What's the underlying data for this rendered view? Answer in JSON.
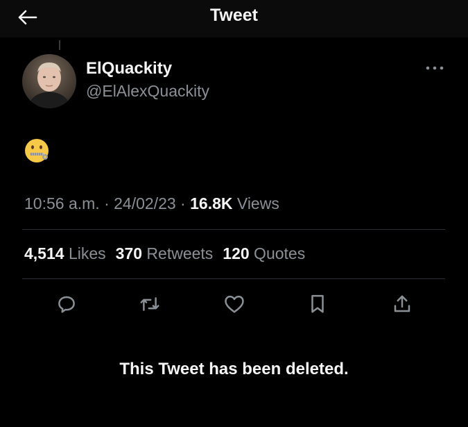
{
  "header": {
    "title": "Tweet",
    "back_icon": "arrow-left-icon"
  },
  "author": {
    "display_name": "ElQuackity",
    "handle": "@ElAlexQuackity",
    "avatar_icon": "user-avatar"
  },
  "tweet": {
    "emoji_icon": "zipper-mouth-face-emoji",
    "time": "10:56 a.m.",
    "separator": " · ",
    "date": "24/02/23",
    "views_count": "16.8K",
    "views_label": " Views"
  },
  "stats": {
    "likes_count": "4,514",
    "likes_label": " Likes",
    "retweets_count": "370",
    "retweets_label": " Retweets",
    "quotes_count": "120",
    "quotes_label": " Quotes"
  },
  "actions": [
    {
      "icon": "reply-icon"
    },
    {
      "icon": "retweet-icon"
    },
    {
      "icon": "like-icon"
    },
    {
      "icon": "bookmark-icon"
    },
    {
      "icon": "share-icon"
    }
  ],
  "status": {
    "deleted_message": "This Tweet has been deleted."
  },
  "colors": {
    "background": "#000000",
    "header_bg": "#0b0b0b",
    "primary_text": "#f5f5f5",
    "secondary_text": "#8b9096",
    "divider": "#2a2d31",
    "emoji_yellow": "#f7c948"
  }
}
